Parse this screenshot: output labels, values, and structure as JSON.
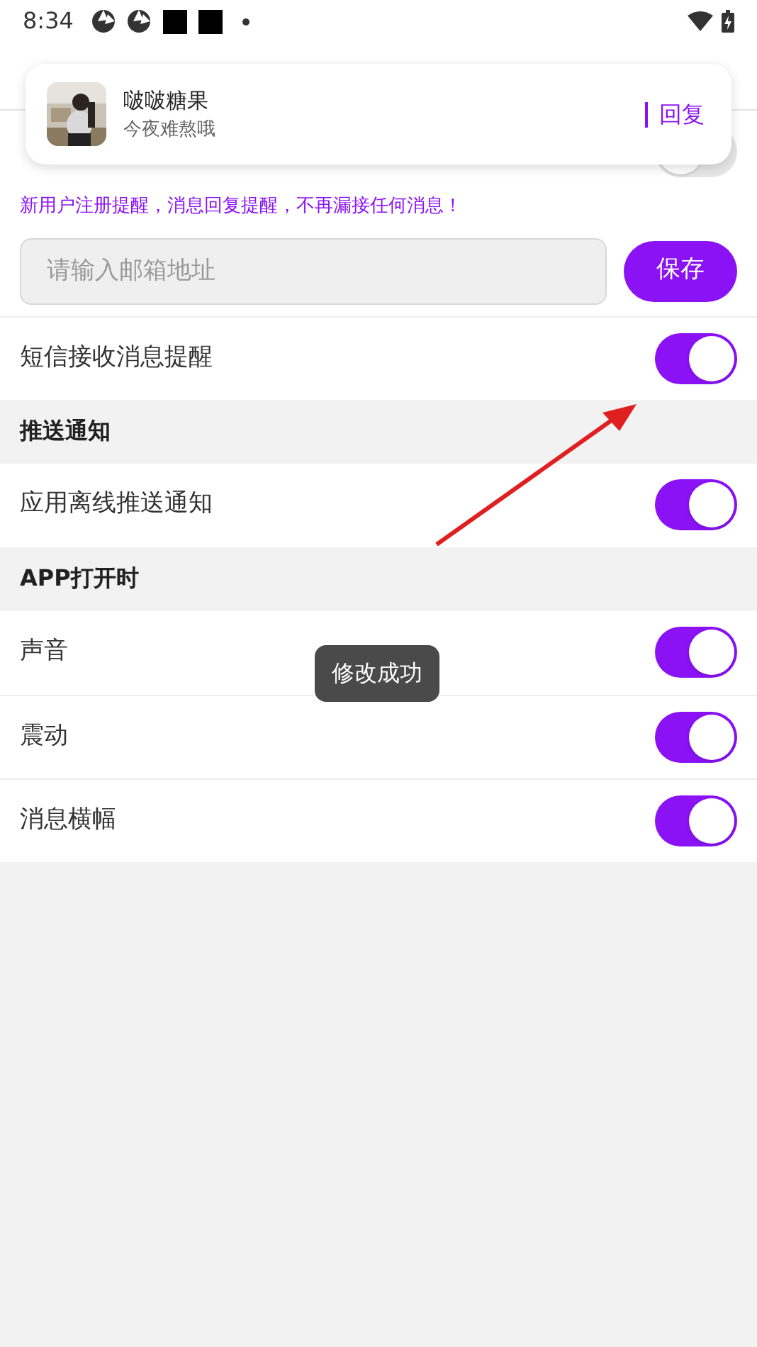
{
  "status_bar": {
    "time": "8:34"
  },
  "notification": {
    "sender": "啵啵糖果",
    "message": "今夜难熬哦",
    "action": "回复"
  },
  "email": {
    "on": false,
    "hint": "新用户注册提醒，消息回复提醒，不再漏接任何消息！",
    "placeholder": "请输入邮箱地址",
    "save": "保存"
  },
  "sms": {
    "label": "短信接收消息提醒",
    "on": true
  },
  "sections": [
    {
      "title": "推送通知",
      "items": [
        {
          "label": "应用离线推送通知",
          "on": true
        }
      ]
    },
    {
      "title": "APP打开时",
      "items": [
        {
          "label": "声音",
          "on": true
        },
        {
          "label": "震动",
          "on": true
        },
        {
          "label": "消息横幅",
          "on": true
        }
      ]
    }
  ],
  "toast": "修改成功"
}
